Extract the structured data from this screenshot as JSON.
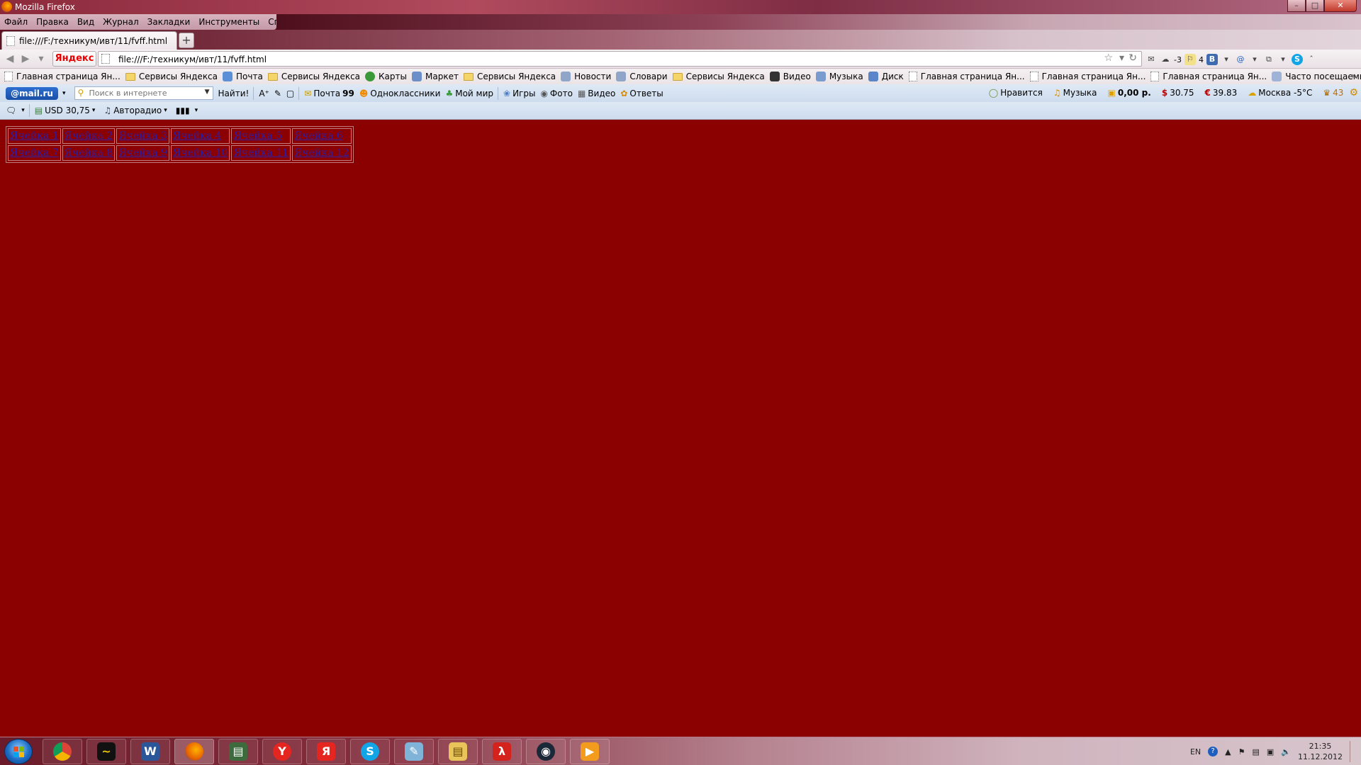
{
  "window": {
    "title": "Mozilla Firefox"
  },
  "menu": [
    "Файл",
    "Правка",
    "Вид",
    "Журнал",
    "Закладки",
    "Инструменты",
    "Справка"
  ],
  "tab": {
    "label": "file:///F:/техникум/ивт/11/fvff.html",
    "new_tab": "+"
  },
  "nav": {
    "yandex_label": "Яндекс",
    "url": "file:///F:/техникум/ивт/11/fvff.html",
    "weather_temp": "-3",
    "notifications": "4"
  },
  "bookmarks": [
    {
      "label": "Главная страница Ян...",
      "icon": "blank-page-icon"
    },
    {
      "label": "Сервисы Яндекса",
      "icon": "folder-icon"
    },
    {
      "label": "Почта",
      "icon": "mail-icon"
    },
    {
      "label": "Сервисы Яндекса",
      "icon": "folder-icon"
    },
    {
      "label": "Карты",
      "icon": "maps-icon"
    },
    {
      "label": "Маркет",
      "icon": "market-icon"
    },
    {
      "label": "Сервисы Яндекса",
      "icon": "folder-icon"
    },
    {
      "label": "Новости",
      "icon": "news-icon"
    },
    {
      "label": "Словари",
      "icon": "dictionary-icon"
    },
    {
      "label": "Сервисы Яндекса",
      "icon": "folder-icon"
    },
    {
      "label": "Видео",
      "icon": "video-icon"
    },
    {
      "label": "Музыка",
      "icon": "music-icon"
    },
    {
      "label": "Диск",
      "icon": "disk-icon"
    },
    {
      "label": "Главная страница Ян...",
      "icon": "blank-page-icon"
    },
    {
      "label": "Главная страница Ян...",
      "icon": "blank-page-icon"
    },
    {
      "label": "Главная страница Ян...",
      "icon": "blank-page-icon"
    },
    {
      "label": "Часто посещаемые",
      "icon": "frequent-icon"
    }
  ],
  "mailru": {
    "logo": "@mail.ru",
    "search_placeholder": "Поиск в интернете",
    "find_button": "Найти!",
    "mail_label": "Почта",
    "mail_count": "99",
    "odnoklassniki": "Одноклассники",
    "my_world": "Мой мир",
    "games": "Игры",
    "photo": "Фото",
    "video": "Видео",
    "answers": "Ответы",
    "likes": "Нравится",
    "music": "Музыка",
    "balance": "0,00 р.",
    "usd_rate": "30.75",
    "eur_rate": "39.83",
    "weather": "Москва -5°C",
    "notif_count": "43"
  },
  "extra_toolbar": {
    "currency": "USD 30,75",
    "radio": "Авторадио"
  },
  "page": {
    "cells": [
      [
        "Ячейка 1",
        "Ячейка 2",
        "Ячейка 3",
        "Ячейка 4",
        "Ячейка 5",
        "Ячейка 6"
      ],
      [
        "Ячейка 7",
        "Ячейка 8",
        "Ячейка 9",
        "Ячейка 10",
        "Ячейка 11",
        "Ячейка 12"
      ]
    ],
    "background": "#8b0000",
    "link_color": "#2a1fa6"
  },
  "taskbar": {
    "apps": [
      "chrome-icon",
      "video-editor-icon",
      "word-icon",
      "firefox-icon",
      "terminal-icon",
      "yandex-browser-icon",
      "yandex-icon",
      "skype-icon",
      "notepad-icon",
      "explorer-icon",
      "acrobat-icon",
      "steam-icon",
      "media-player-icon"
    ],
    "lang": "EN",
    "time": "21:35",
    "date": "11.12.2012"
  }
}
